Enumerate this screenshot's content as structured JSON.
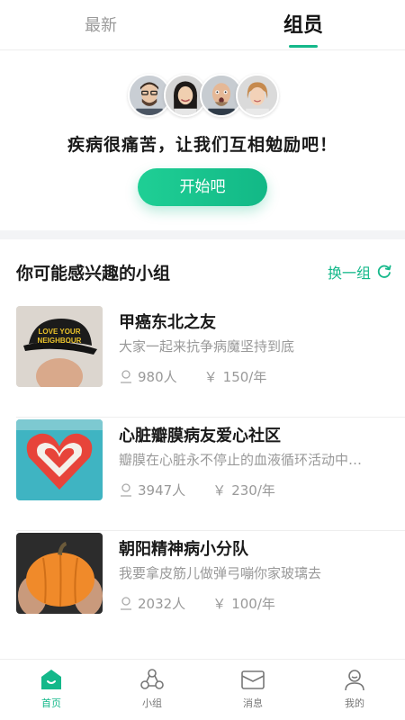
{
  "top_tabs": {
    "latest": "最新",
    "members": "组员"
  },
  "hero": {
    "slogan": "疾病很痛苦，让我们互相勉励吧！",
    "button_label": "开始吧"
  },
  "section": {
    "title": "你可能感兴趣的小组",
    "switch_label": "换一组"
  },
  "groups": [
    {
      "name": "甲癌东北之友",
      "desc": "大家一起来抗争病魔坚持到底",
      "members": "980人",
      "fee": "150/年",
      "thumb": "cap-photo"
    },
    {
      "name": "心脏瓣膜病友爱心社区",
      "desc": "瓣膜在心脏永不停止的血液循环活动中…",
      "members": "3947人",
      "fee": "230/年",
      "thumb": "heart-graffiti"
    },
    {
      "name": "朝阳精神病小分队",
      "desc": "我要拿皮筋儿做弹弓嘣你家玻璃去",
      "members": "2032人",
      "fee": "100/年",
      "thumb": "pumpkin-photo"
    }
  ],
  "meta": {
    "yen_symbol": "￥"
  },
  "tabbar": {
    "home": "首页",
    "group": "小组",
    "message": "消息",
    "me": "我的"
  },
  "colors": {
    "accent": "#14b88a",
    "muted": "#999999"
  }
}
